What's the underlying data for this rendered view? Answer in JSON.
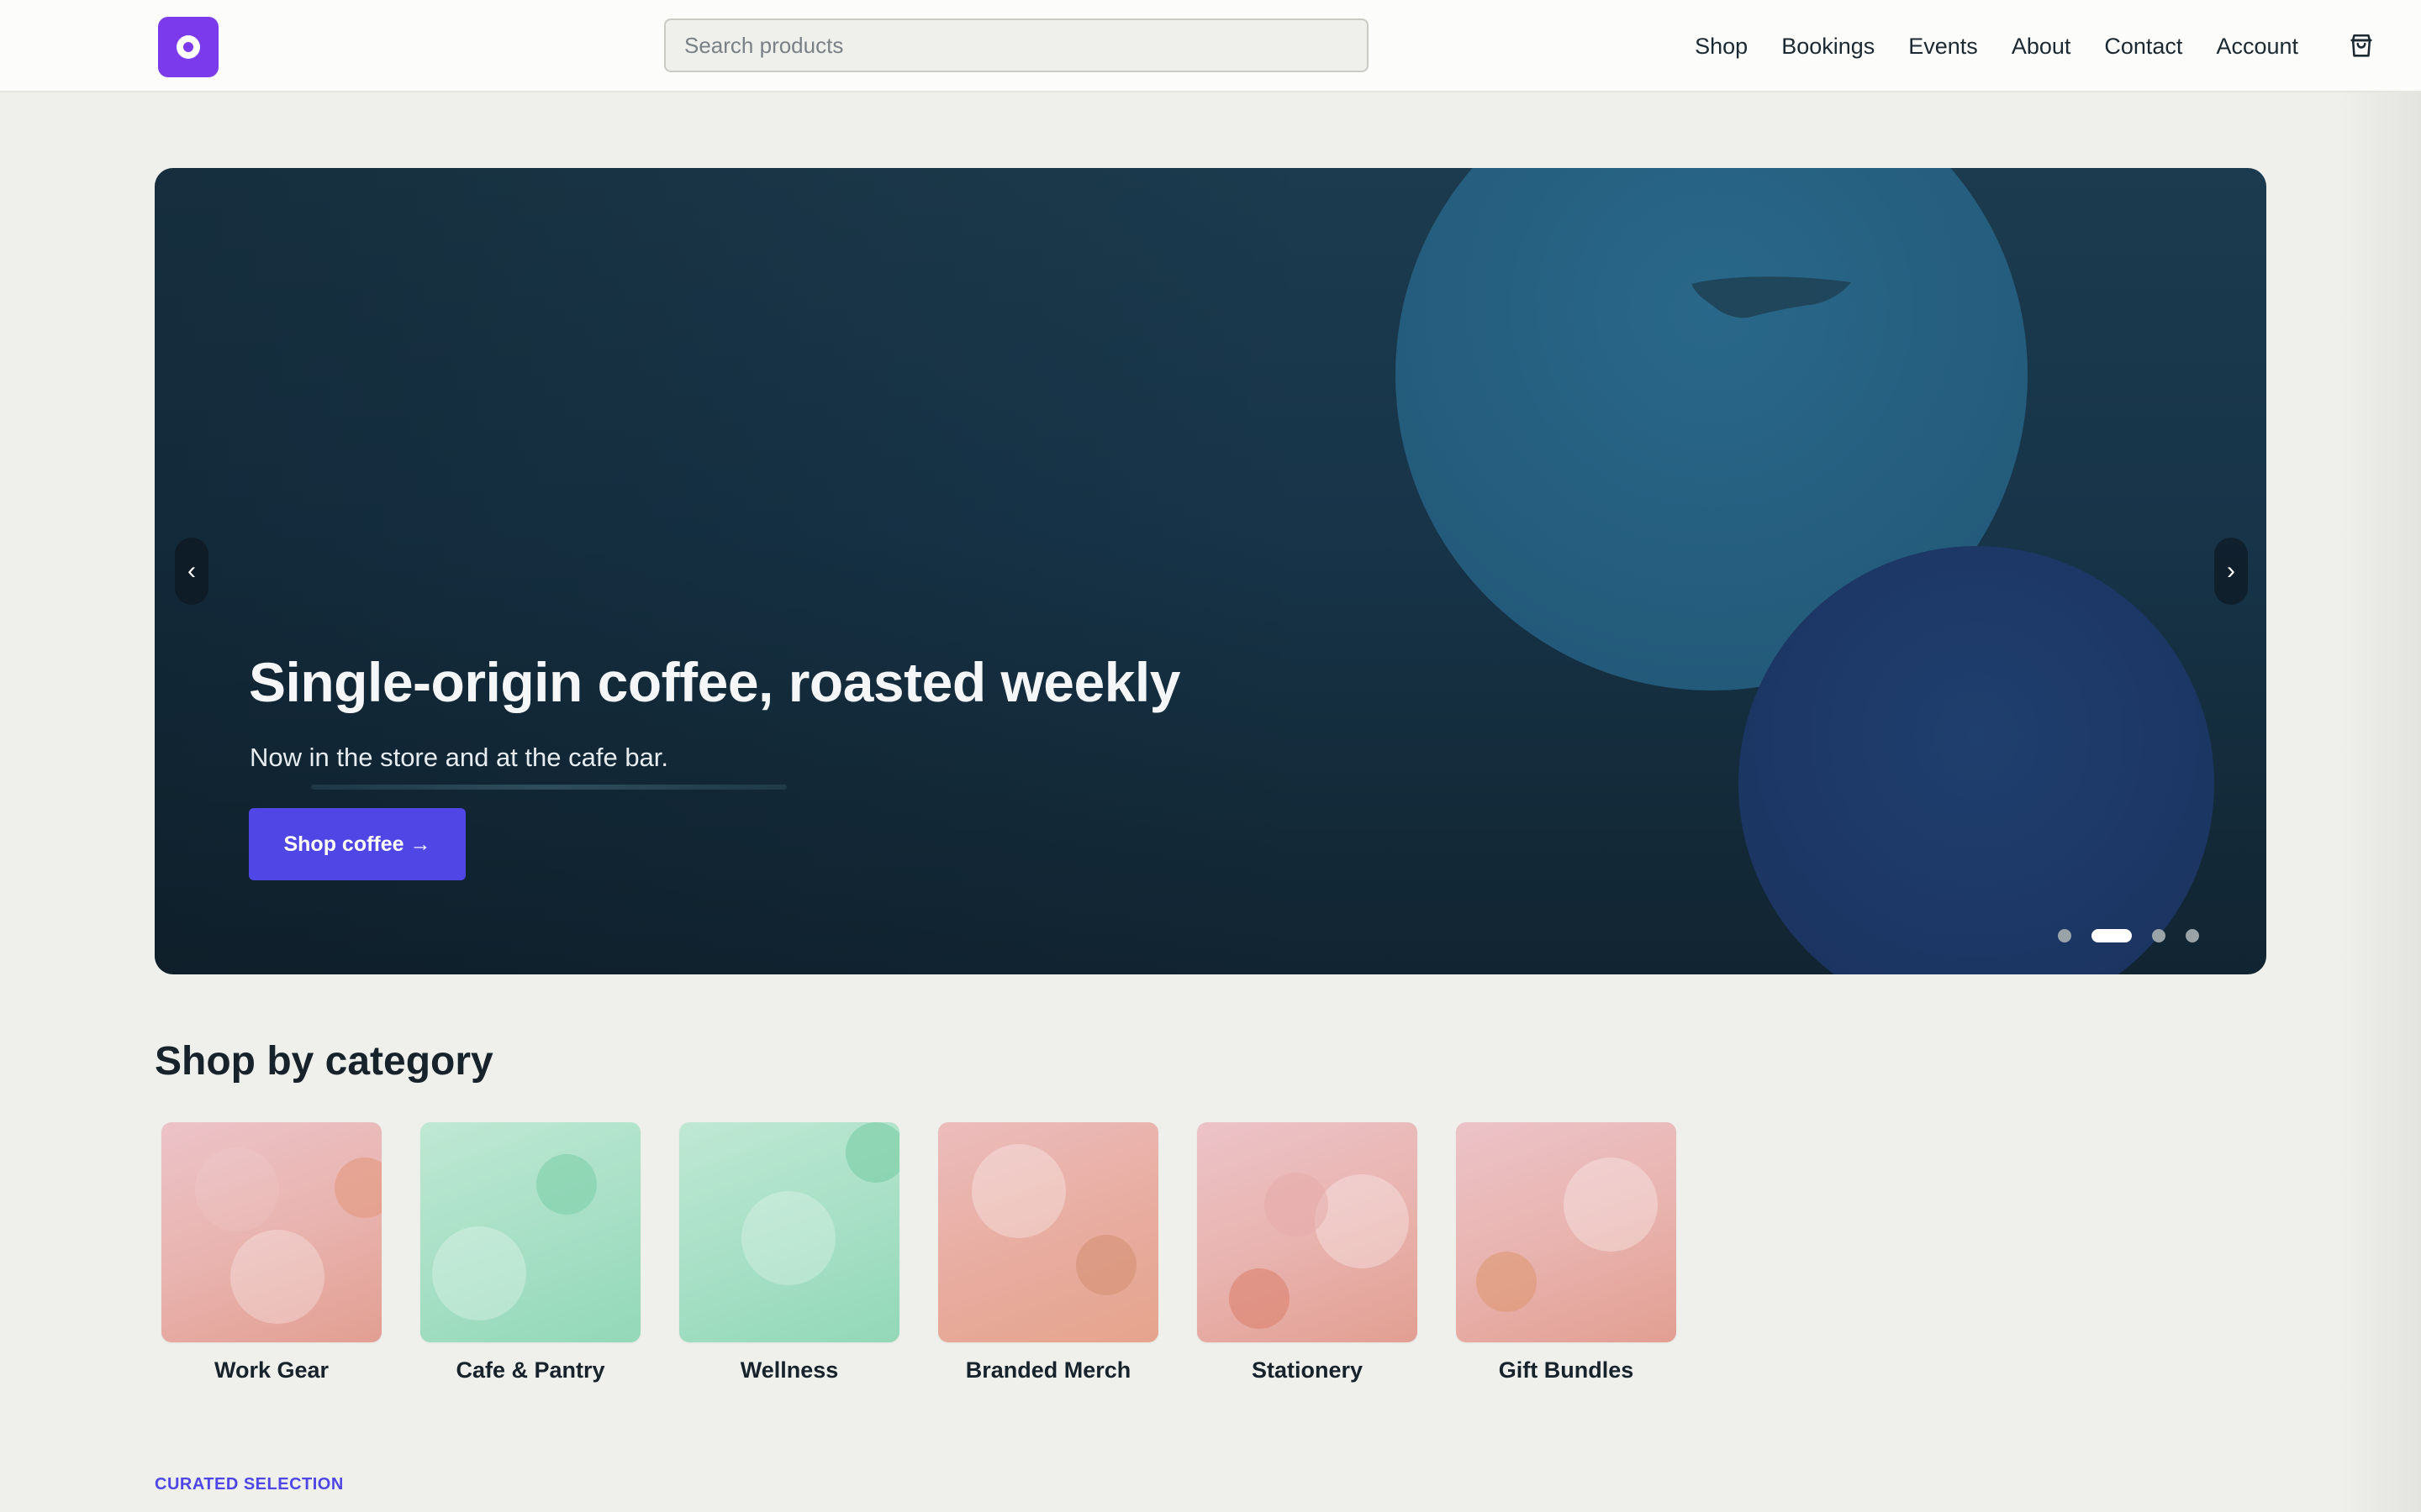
{
  "header": {
    "search_placeholder": "Search products",
    "nav": [
      "Shop",
      "Bookings",
      "Events",
      "About",
      "Contact",
      "Account"
    ],
    "logo_icon": "circle-logo-icon",
    "cart_icon": "shopping-bag-icon"
  },
  "hero": {
    "title": "Single-origin coffee, roasted weekly",
    "subtitle": "Now in the store and at the cafe bar.",
    "cta_label": "Shop coffee →",
    "prev_label": "‹",
    "next_label": "›",
    "slide_count": 4,
    "active_slide": 2
  },
  "categories": {
    "heading": "Shop by category",
    "items": [
      {
        "label": "Work Gear"
      },
      {
        "label": "Cafe & Pantry"
      },
      {
        "label": "Wellness"
      },
      {
        "label": "Branded Merch"
      },
      {
        "label": "Stationery"
      },
      {
        "label": "Gift Bundles"
      }
    ]
  },
  "curated": {
    "eyebrow": "CURATED SELECTION"
  },
  "colors": {
    "accent": "#4f46e5",
    "logo": "#7c3aed",
    "background": "#eff0ec"
  }
}
